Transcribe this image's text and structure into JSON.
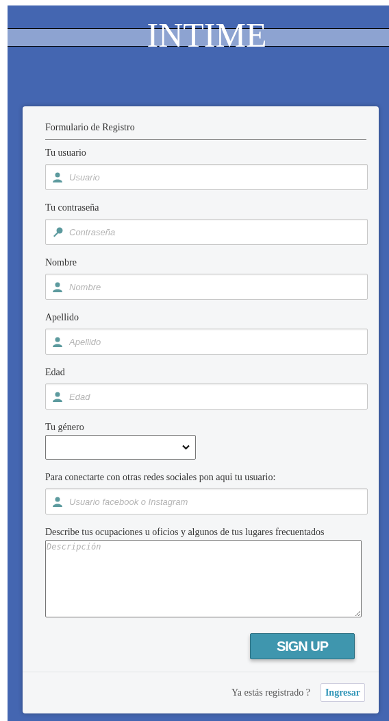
{
  "header": {
    "title": "INTIME"
  },
  "form": {
    "title": "Formulario de Registro",
    "fields": [
      {
        "kind": "text",
        "label": "Tu usuario",
        "placeholder": "Usuario"
      },
      {
        "kind": "password",
        "label": "Tu contraseña",
        "placeholder": "Contraseña"
      },
      {
        "kind": "text",
        "label": "Nombre",
        "placeholder": "Nombre"
      },
      {
        "kind": "text",
        "label": "Apellido",
        "placeholder": "Apellido"
      },
      {
        "kind": "text",
        "label": "Edad",
        "placeholder": "Edad"
      },
      {
        "kind": "select",
        "label": "Tu género"
      },
      {
        "kind": "text",
        "label": "Para conectarte con otras redes sociales pon aqui tu usuario:",
        "placeholder": "Usuario facebook o Instagram"
      },
      {
        "kind": "textarea",
        "label": "Describe tus ocupaciones u oficios y algunos de tus lugares frecuentados",
        "placeholder": "Descripción"
      }
    ],
    "submit": "SIGN UP"
  },
  "footer": {
    "question": "Ya estás registrado ?",
    "link": "Ingresar"
  }
}
